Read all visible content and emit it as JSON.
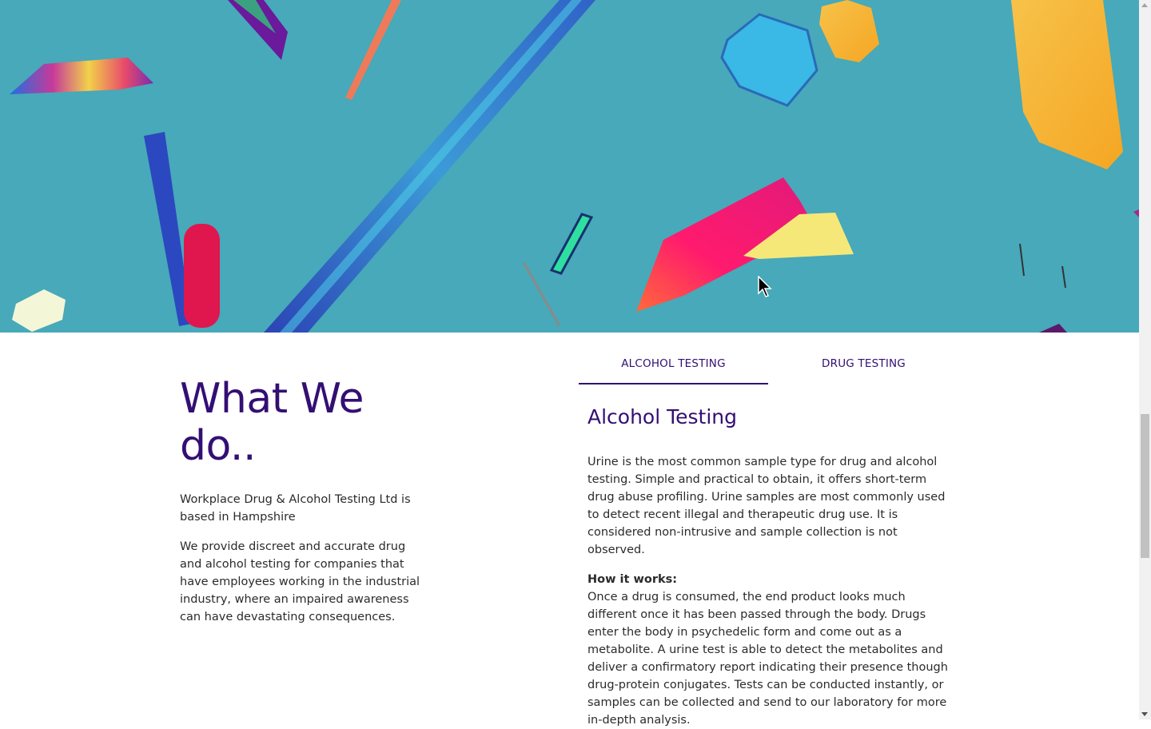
{
  "hero": {
    "image_name": "crystal-microscopy-hero",
    "background_color": "#47a9b9"
  },
  "about": {
    "heading": "What We do..",
    "paragraph_1": "Workplace Drug & Alcohol Testing Ltd is based in Hampshire",
    "paragraph_2": "We provide discreet and accurate drug and alcohol testing for companies that have employees working in the industrial industry, where an impaired awareness can have devastating consequences."
  },
  "tabs": [
    {
      "label": "ALCOHOL TESTING",
      "active": true
    },
    {
      "label": "DRUG TESTING",
      "active": false
    }
  ],
  "panel": {
    "title": "Alcohol Testing",
    "intro": "Urine is the most common sample type for drug and alcohol testing. Simple and practical to obtain, it offers short-term drug abuse profiling. Urine samples are most commonly used to detect recent illegal and therapeutic drug use. It is considered non-intrusive and sample collection is not observed.",
    "how_title": "How it works:",
    "how_text": "Once a drug is consumed, the end product looks much different once it has been passed through the body. Drugs enter the body in psychedelic form and come out as a metabolite. A urine test is able to detect the metabolites and deliver a confirmatory report indicating their presence though drug-protein conjugates. Tests can be conducted instantly, or samples can be collected and send to our laboratory for more in-depth analysis."
  },
  "colors": {
    "accent": "#330f73",
    "text": "#2b2b2b"
  }
}
